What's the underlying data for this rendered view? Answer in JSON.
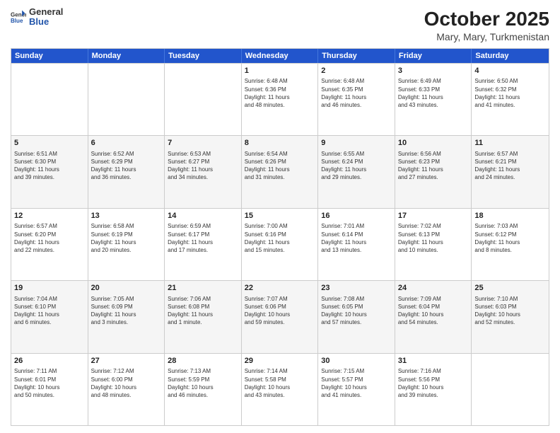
{
  "header": {
    "logo_general": "General",
    "logo_blue": "Blue",
    "title": "October 2025",
    "subtitle": "Mary, Mary, Turkmenistan"
  },
  "days_of_week": [
    "Sunday",
    "Monday",
    "Tuesday",
    "Wednesday",
    "Thursday",
    "Friday",
    "Saturday"
  ],
  "weeks": [
    [
      {
        "day": "",
        "text": ""
      },
      {
        "day": "",
        "text": ""
      },
      {
        "day": "",
        "text": ""
      },
      {
        "day": "1",
        "text": "Sunrise: 6:48 AM\nSunset: 6:36 PM\nDaylight: 11 hours\nand 48 minutes."
      },
      {
        "day": "2",
        "text": "Sunrise: 6:48 AM\nSunset: 6:35 PM\nDaylight: 11 hours\nand 46 minutes."
      },
      {
        "day": "3",
        "text": "Sunrise: 6:49 AM\nSunset: 6:33 PM\nDaylight: 11 hours\nand 43 minutes."
      },
      {
        "day": "4",
        "text": "Sunrise: 6:50 AM\nSunset: 6:32 PM\nDaylight: 11 hours\nand 41 minutes."
      }
    ],
    [
      {
        "day": "5",
        "text": "Sunrise: 6:51 AM\nSunset: 6:30 PM\nDaylight: 11 hours\nand 39 minutes."
      },
      {
        "day": "6",
        "text": "Sunrise: 6:52 AM\nSunset: 6:29 PM\nDaylight: 11 hours\nand 36 minutes."
      },
      {
        "day": "7",
        "text": "Sunrise: 6:53 AM\nSunset: 6:27 PM\nDaylight: 11 hours\nand 34 minutes."
      },
      {
        "day": "8",
        "text": "Sunrise: 6:54 AM\nSunset: 6:26 PM\nDaylight: 11 hours\nand 31 minutes."
      },
      {
        "day": "9",
        "text": "Sunrise: 6:55 AM\nSunset: 6:24 PM\nDaylight: 11 hours\nand 29 minutes."
      },
      {
        "day": "10",
        "text": "Sunrise: 6:56 AM\nSunset: 6:23 PM\nDaylight: 11 hours\nand 27 minutes."
      },
      {
        "day": "11",
        "text": "Sunrise: 6:57 AM\nSunset: 6:21 PM\nDaylight: 11 hours\nand 24 minutes."
      }
    ],
    [
      {
        "day": "12",
        "text": "Sunrise: 6:57 AM\nSunset: 6:20 PM\nDaylight: 11 hours\nand 22 minutes."
      },
      {
        "day": "13",
        "text": "Sunrise: 6:58 AM\nSunset: 6:19 PM\nDaylight: 11 hours\nand 20 minutes."
      },
      {
        "day": "14",
        "text": "Sunrise: 6:59 AM\nSunset: 6:17 PM\nDaylight: 11 hours\nand 17 minutes."
      },
      {
        "day": "15",
        "text": "Sunrise: 7:00 AM\nSunset: 6:16 PM\nDaylight: 11 hours\nand 15 minutes."
      },
      {
        "day": "16",
        "text": "Sunrise: 7:01 AM\nSunset: 6:14 PM\nDaylight: 11 hours\nand 13 minutes."
      },
      {
        "day": "17",
        "text": "Sunrise: 7:02 AM\nSunset: 6:13 PM\nDaylight: 11 hours\nand 10 minutes."
      },
      {
        "day": "18",
        "text": "Sunrise: 7:03 AM\nSunset: 6:12 PM\nDaylight: 11 hours\nand 8 minutes."
      }
    ],
    [
      {
        "day": "19",
        "text": "Sunrise: 7:04 AM\nSunset: 6:10 PM\nDaylight: 11 hours\nand 6 minutes."
      },
      {
        "day": "20",
        "text": "Sunrise: 7:05 AM\nSunset: 6:09 PM\nDaylight: 11 hours\nand 3 minutes."
      },
      {
        "day": "21",
        "text": "Sunrise: 7:06 AM\nSunset: 6:08 PM\nDaylight: 11 hours\nand 1 minute."
      },
      {
        "day": "22",
        "text": "Sunrise: 7:07 AM\nSunset: 6:06 PM\nDaylight: 10 hours\nand 59 minutes."
      },
      {
        "day": "23",
        "text": "Sunrise: 7:08 AM\nSunset: 6:05 PM\nDaylight: 10 hours\nand 57 minutes."
      },
      {
        "day": "24",
        "text": "Sunrise: 7:09 AM\nSunset: 6:04 PM\nDaylight: 10 hours\nand 54 minutes."
      },
      {
        "day": "25",
        "text": "Sunrise: 7:10 AM\nSunset: 6:03 PM\nDaylight: 10 hours\nand 52 minutes."
      }
    ],
    [
      {
        "day": "26",
        "text": "Sunrise: 7:11 AM\nSunset: 6:01 PM\nDaylight: 10 hours\nand 50 minutes."
      },
      {
        "day": "27",
        "text": "Sunrise: 7:12 AM\nSunset: 6:00 PM\nDaylight: 10 hours\nand 48 minutes."
      },
      {
        "day": "28",
        "text": "Sunrise: 7:13 AM\nSunset: 5:59 PM\nDaylight: 10 hours\nand 46 minutes."
      },
      {
        "day": "29",
        "text": "Sunrise: 7:14 AM\nSunset: 5:58 PM\nDaylight: 10 hours\nand 43 minutes."
      },
      {
        "day": "30",
        "text": "Sunrise: 7:15 AM\nSunset: 5:57 PM\nDaylight: 10 hours\nand 41 minutes."
      },
      {
        "day": "31",
        "text": "Sunrise: 7:16 AM\nSunset: 5:56 PM\nDaylight: 10 hours\nand 39 minutes."
      },
      {
        "day": "",
        "text": ""
      }
    ]
  ]
}
